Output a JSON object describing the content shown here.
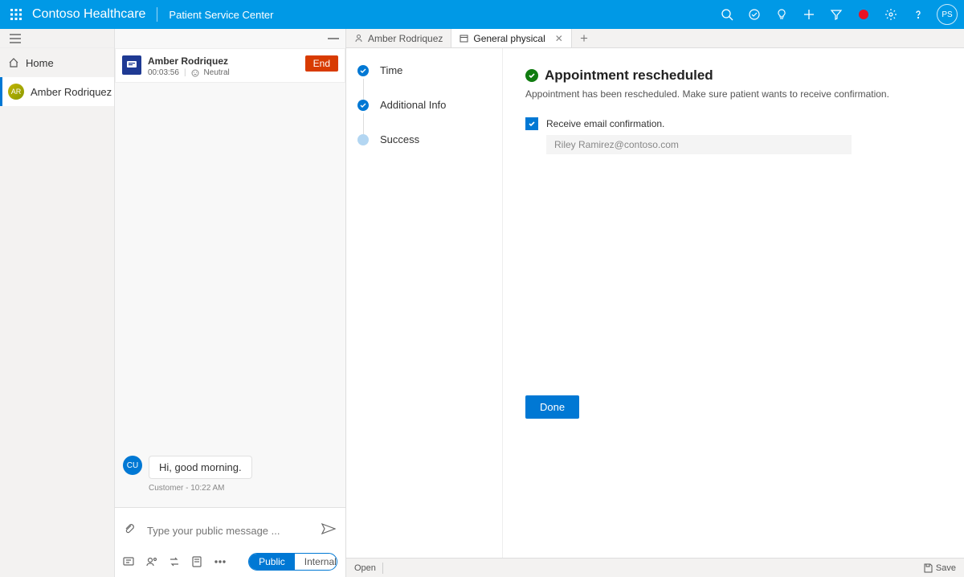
{
  "topbar": {
    "brand": "Contoso Healthcare",
    "subtitle": "Patient Service Center",
    "avatar_initials": "PS"
  },
  "leftnav": {
    "home": "Home",
    "contact": "Amber Rodriquez",
    "contact_initials": "AR"
  },
  "conversation": {
    "name": "Amber Rodriquez",
    "duration": "00:03:56",
    "sentiment": "Neutral",
    "end_label": "End",
    "message_text": "Hi, good morning.",
    "message_avatar": "CU",
    "message_meta": "Customer - 10:22 AM",
    "compose_placeholder": "Type your public message ...",
    "toggle_public": "Public",
    "toggle_internal": "Internal"
  },
  "tabs": {
    "tab1": "Amber Rodriquez",
    "tab2": "General physical"
  },
  "steps": {
    "s1": "Time",
    "s2": "Additional Info",
    "s3": "Success"
  },
  "main": {
    "heading": "Appointment rescheduled",
    "subtext": "Appointment has been rescheduled. Make sure patient wants to receive confirmation.",
    "checkbox_label": "Receive email confirmation.",
    "email_value": "Riley Ramirez@contoso.com",
    "done_label": "Done"
  },
  "footer": {
    "open": "Open",
    "save": "Save"
  }
}
